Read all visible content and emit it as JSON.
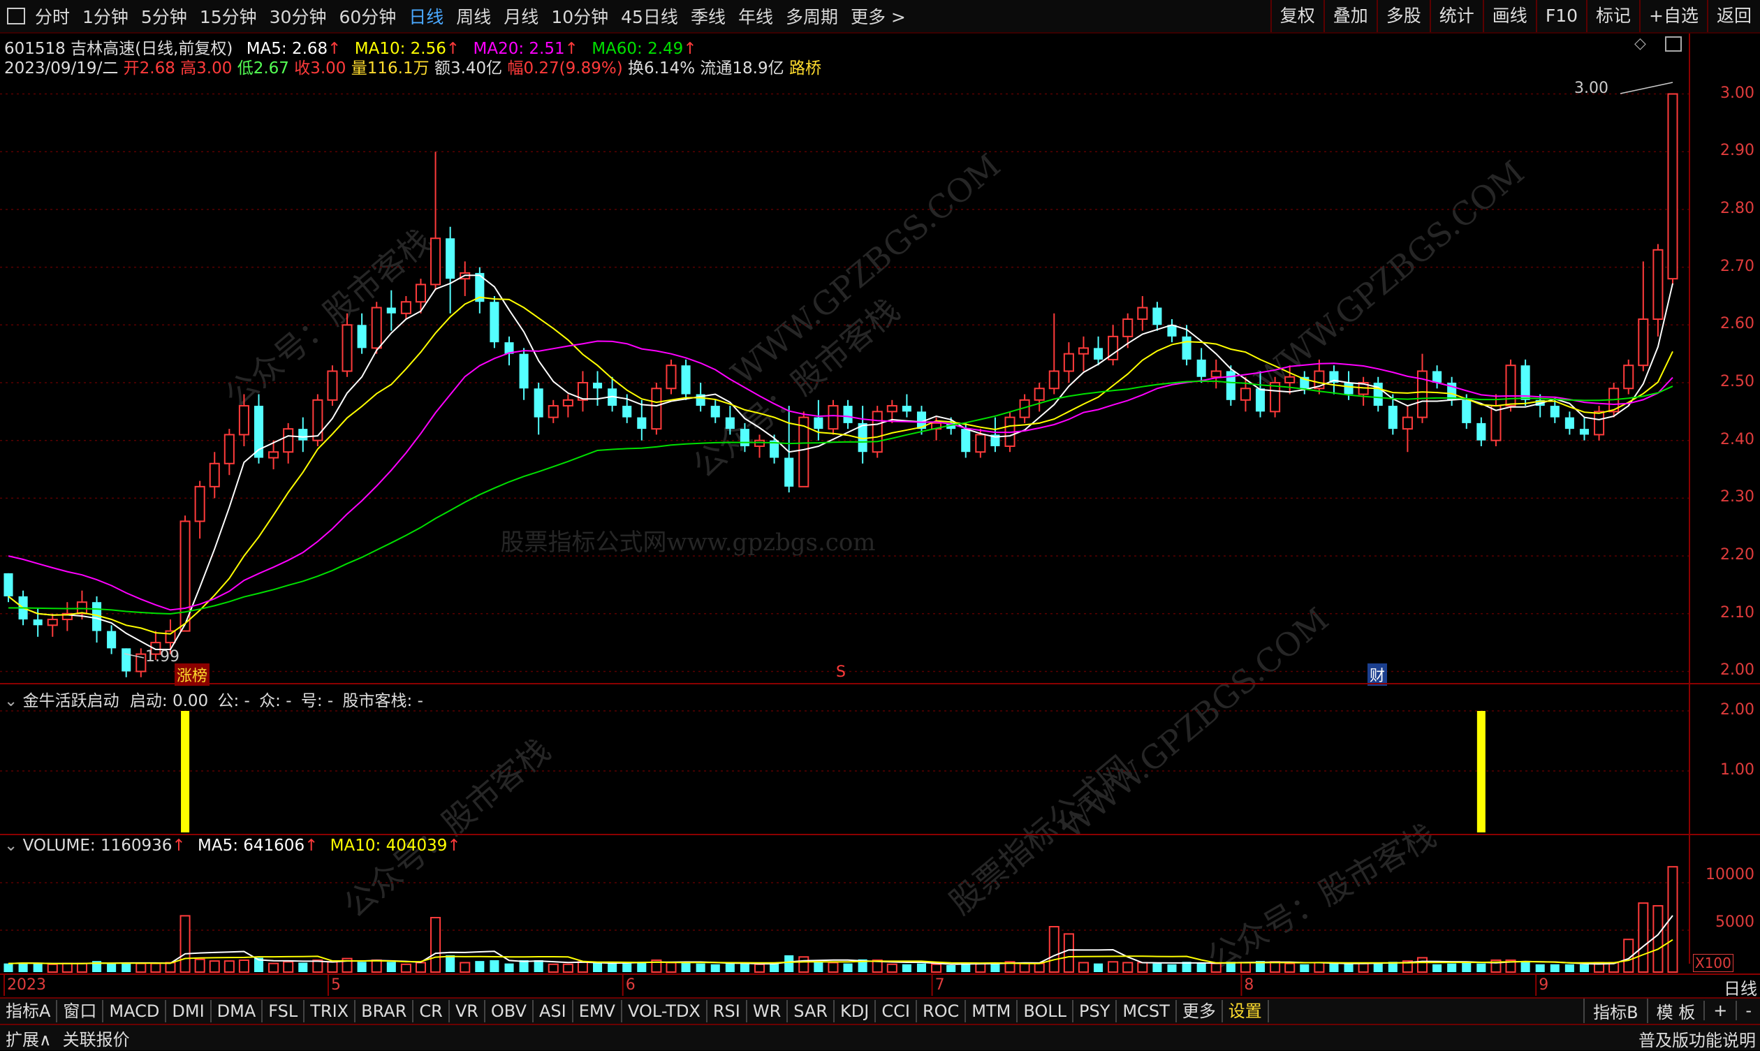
{
  "periods": {
    "items": [
      "分时",
      "1分钟",
      "5分钟",
      "15分钟",
      "30分钟",
      "60分钟",
      "日线",
      "周线",
      "月线",
      "10分钟",
      "45日线",
      "季线",
      "年线",
      "多周期",
      "更多 >"
    ],
    "active": "日线"
  },
  "right_tools": [
    "复权",
    "叠加",
    "多股",
    "统计",
    "画线",
    "F10",
    "标记",
    "+自选",
    "返回"
  ],
  "stock": {
    "code_name": "601518 吉林高速(日线,前复权)",
    "ma5": "MA5: 2.68",
    "ma10": "MA10: 2.56",
    "ma20": "MA20: 2.51",
    "ma60": "MA60: 2.49"
  },
  "quote": {
    "date": "2023/09/19/二",
    "open": "开2.68",
    "high": "高3.00",
    "low": "低2.67",
    "close": "收3.00",
    "volume": "量116.1万",
    "amount": "额3.40亿",
    "range": "幅0.27(9.89%)",
    "turnover": "换6.14%",
    "float": "流通18.9亿",
    "tag": "路桥"
  },
  "main_axis": {
    "labels": [
      "3.00",
      "2.90",
      "2.80",
      "2.70",
      "2.60",
      "2.50",
      "2.40",
      "2.30",
      "2.20",
      "2.10",
      "2.00"
    ]
  },
  "annotations": {
    "high": "3.00",
    "low": "1.99",
    "zhangbang": "涨榜",
    "s_mark": "S",
    "cai": "财"
  },
  "indicator": {
    "title": "金牛活跃启动",
    "startup": "启动: 0.00",
    "p1": "公: -",
    "p2": "众: -",
    "p3": "号: -",
    "p4": "股市客栈: -",
    "axis": [
      "2.00",
      "1.00"
    ]
  },
  "volume_panel": {
    "vol": "VOLUME: 1160936",
    "ma5": "MA5: 641606",
    "ma10": "MA10: 404039",
    "axis": [
      "10000",
      "5000"
    ],
    "unit": "X100"
  },
  "x_axis": {
    "labels": [
      "2023年4",
      "5",
      "6",
      "7",
      "8",
      "9"
    ],
    "period": "日线"
  },
  "tabs": {
    "items": [
      "指标A",
      "窗口",
      "MACD",
      "DMI",
      "DMA",
      "FSL",
      "TRIX",
      "BRAR",
      "CR",
      "VR",
      "OBV",
      "ASI",
      "EMV",
      "VOL-TDX",
      "RSI",
      "WR",
      "SAR",
      "KDJ",
      "CCI",
      "ROC",
      "MTM",
      "BOLL",
      "PSY",
      "MCST",
      "更多",
      "设置"
    ],
    "active": "设置",
    "right": [
      "指标B",
      "模 板",
      "+",
      "-"
    ]
  },
  "status": {
    "left": [
      "扩展∧",
      "关联报价"
    ],
    "right": "普及版功能说明"
  },
  "watermarks": [
    "公众号：股市客栈",
    "WWW.GPZBGS.COM",
    "股票指标公式网",
    "股票指标公式网www.gpzbgs.com"
  ],
  "colors": {
    "up": "#ff3b3b",
    "down": "#54ffff",
    "ma5": "#ffffff",
    "ma10": "#ffff00",
    "ma20": "#ff00ff",
    "ma60": "#00e000",
    "accent": "#4aa8ff",
    "axis": "#e03c3c"
  },
  "chart_data": [
    {
      "type": "candlestick",
      "title": "601518 吉林高速(日线,前复权)",
      "ylim": [
        1.98,
        3.02
      ],
      "ohlc": [
        [
          2.17,
          2.17,
          2.12,
          2.13
        ],
        [
          2.13,
          2.14,
          2.08,
          2.09
        ],
        [
          2.09,
          2.11,
          2.06,
          2.08
        ],
        [
          2.08,
          2.1,
          2.06,
          2.09
        ],
        [
          2.09,
          2.12,
          2.07,
          2.1
        ],
        [
          2.1,
          2.14,
          2.09,
          2.12
        ],
        [
          2.12,
          2.13,
          2.05,
          2.07
        ],
        [
          2.07,
          2.08,
          2.03,
          2.04
        ],
        [
          2.04,
          2.04,
          1.99,
          2.0
        ],
        [
          2.0,
          2.04,
          1.99,
          2.03
        ],
        [
          2.03,
          2.07,
          2.02,
          2.05
        ],
        [
          2.05,
          2.09,
          2.03,
          2.07
        ],
        [
          2.07,
          2.27,
          2.07,
          2.26
        ],
        [
          2.26,
          2.33,
          2.23,
          2.32
        ],
        [
          2.32,
          2.38,
          2.3,
          2.36
        ],
        [
          2.36,
          2.42,
          2.34,
          2.41
        ],
        [
          2.41,
          2.48,
          2.39,
          2.46
        ],
        [
          2.46,
          2.48,
          2.36,
          2.37
        ],
        [
          2.37,
          2.4,
          2.35,
          2.38
        ],
        [
          2.38,
          2.43,
          2.36,
          2.42
        ],
        [
          2.42,
          2.44,
          2.38,
          2.4
        ],
        [
          2.4,
          2.48,
          2.39,
          2.47
        ],
        [
          2.47,
          2.53,
          2.46,
          2.52
        ],
        [
          2.52,
          2.62,
          2.51,
          2.6
        ],
        [
          2.6,
          2.62,
          2.55,
          2.56
        ],
        [
          2.56,
          2.64,
          2.55,
          2.63
        ],
        [
          2.63,
          2.66,
          2.59,
          2.62
        ],
        [
          2.62,
          2.65,
          2.61,
          2.64
        ],
        [
          2.64,
          2.68,
          2.62,
          2.67
        ],
        [
          2.67,
          2.9,
          2.66,
          2.75
        ],
        [
          2.75,
          2.77,
          2.62,
          2.68
        ],
        [
          2.68,
          2.71,
          2.65,
          2.69
        ],
        [
          2.69,
          2.7,
          2.62,
          2.64
        ],
        [
          2.64,
          2.65,
          2.56,
          2.57
        ],
        [
          2.57,
          2.58,
          2.53,
          2.55
        ],
        [
          2.55,
          2.56,
          2.47,
          2.49
        ],
        [
          2.49,
          2.5,
          2.41,
          2.44
        ],
        [
          2.44,
          2.47,
          2.43,
          2.46
        ],
        [
          2.46,
          2.48,
          2.44,
          2.47
        ],
        [
          2.47,
          2.52,
          2.45,
          2.5
        ],
        [
          2.5,
          2.52,
          2.46,
          2.49
        ],
        [
          2.49,
          2.51,
          2.45,
          2.46
        ],
        [
          2.46,
          2.48,
          2.43,
          2.44
        ],
        [
          2.44,
          2.47,
          2.4,
          2.42
        ],
        [
          2.42,
          2.5,
          2.41,
          2.49
        ],
        [
          2.49,
          2.54,
          2.48,
          2.53
        ],
        [
          2.53,
          2.54,
          2.47,
          2.48
        ],
        [
          2.48,
          2.5,
          2.45,
          2.46
        ],
        [
          2.46,
          2.47,
          2.43,
          2.44
        ],
        [
          2.44,
          2.46,
          2.41,
          2.42
        ],
        [
          2.42,
          2.43,
          2.38,
          2.39
        ],
        [
          2.39,
          2.41,
          2.37,
          2.4
        ],
        [
          2.4,
          2.41,
          2.36,
          2.37
        ],
        [
          2.37,
          2.46,
          2.31,
          2.32
        ],
        [
          2.32,
          2.45,
          2.32,
          2.44
        ],
        [
          2.44,
          2.47,
          2.4,
          2.42
        ],
        [
          2.42,
          2.47,
          2.41,
          2.46
        ],
        [
          2.46,
          2.47,
          2.42,
          2.43
        ],
        [
          2.43,
          2.46,
          2.36,
          2.38
        ],
        [
          2.38,
          2.46,
          2.37,
          2.45
        ],
        [
          2.45,
          2.47,
          2.43,
          2.46
        ],
        [
          2.46,
          2.48,
          2.44,
          2.45
        ],
        [
          2.45,
          2.46,
          2.41,
          2.42
        ],
        [
          2.42,
          2.44,
          2.4,
          2.43
        ],
        [
          2.43,
          2.44,
          2.41,
          2.42
        ],
        [
          2.42,
          2.43,
          2.37,
          2.38
        ],
        [
          2.38,
          2.42,
          2.37,
          2.41
        ],
        [
          2.41,
          2.44,
          2.38,
          2.39
        ],
        [
          2.39,
          2.45,
          2.38,
          2.44
        ],
        [
          2.44,
          2.48,
          2.43,
          2.47
        ],
        [
          2.47,
          2.5,
          2.45,
          2.49
        ],
        [
          2.49,
          2.62,
          2.48,
          2.52
        ],
        [
          2.52,
          2.57,
          2.5,
          2.55
        ],
        [
          2.55,
          2.58,
          2.52,
          2.56
        ],
        [
          2.56,
          2.58,
          2.53,
          2.54
        ],
        [
          2.54,
          2.6,
          2.53,
          2.58
        ],
        [
          2.58,
          2.62,
          2.56,
          2.61
        ],
        [
          2.61,
          2.65,
          2.59,
          2.63
        ],
        [
          2.63,
          2.64,
          2.59,
          2.6
        ],
        [
          2.6,
          2.61,
          2.57,
          2.58
        ],
        [
          2.58,
          2.6,
          2.53,
          2.54
        ],
        [
          2.54,
          2.56,
          2.5,
          2.51
        ],
        [
          2.51,
          2.54,
          2.49,
          2.52
        ],
        [
          2.52,
          2.53,
          2.46,
          2.47
        ],
        [
          2.47,
          2.51,
          2.45,
          2.49
        ],
        [
          2.49,
          2.52,
          2.44,
          2.45
        ],
        [
          2.45,
          2.51,
          2.44,
          2.5
        ],
        [
          2.5,
          2.53,
          2.48,
          2.51
        ],
        [
          2.51,
          2.52,
          2.48,
          2.49
        ],
        [
          2.49,
          2.54,
          2.48,
          2.52
        ],
        [
          2.52,
          2.53,
          2.48,
          2.5
        ],
        [
          2.5,
          2.52,
          2.47,
          2.48
        ],
        [
          2.48,
          2.51,
          2.46,
          2.5
        ],
        [
          2.5,
          2.51,
          2.45,
          2.46
        ],
        [
          2.46,
          2.48,
          2.41,
          2.42
        ],
        [
          2.42,
          2.46,
          2.38,
          2.44
        ],
        [
          2.44,
          2.55,
          2.43,
          2.52
        ],
        [
          2.52,
          2.53,
          2.49,
          2.5
        ],
        [
          2.5,
          2.51,
          2.46,
          2.47
        ],
        [
          2.47,
          2.48,
          2.42,
          2.43
        ],
        [
          2.43,
          2.44,
          2.39,
          2.4
        ],
        [
          2.4,
          2.48,
          2.39,
          2.46
        ],
        [
          2.46,
          2.54,
          2.45,
          2.53
        ],
        [
          2.53,
          2.54,
          2.46,
          2.47
        ],
        [
          2.47,
          2.48,
          2.44,
          2.46
        ],
        [
          2.46,
          2.47,
          2.43,
          2.44
        ],
        [
          2.44,
          2.45,
          2.41,
          2.42
        ],
        [
          2.42,
          2.44,
          2.4,
          2.41
        ],
        [
          2.41,
          2.46,
          2.4,
          2.45
        ],
        [
          2.45,
          2.5,
          2.44,
          2.49
        ],
        [
          2.49,
          2.54,
          2.48,
          2.53
        ],
        [
          2.53,
          2.71,
          2.52,
          2.61
        ],
        [
          2.61,
          2.74,
          2.58,
          2.73
        ],
        [
          2.68,
          3.0,
          2.67,
          3.0
        ]
      ]
    },
    {
      "type": "bar",
      "title": "金牛活跃启动",
      "signal_bars": [
        {
          "index": 12,
          "value": 2.0
        },
        {
          "index": 100,
          "value": 2.0
        }
      ],
      "ylim": [
        0,
        2.2
      ]
    },
    {
      "type": "bar",
      "title": "VOLUME",
      "unit": "X100",
      "ylim": [
        0,
        12000
      ]
    }
  ]
}
